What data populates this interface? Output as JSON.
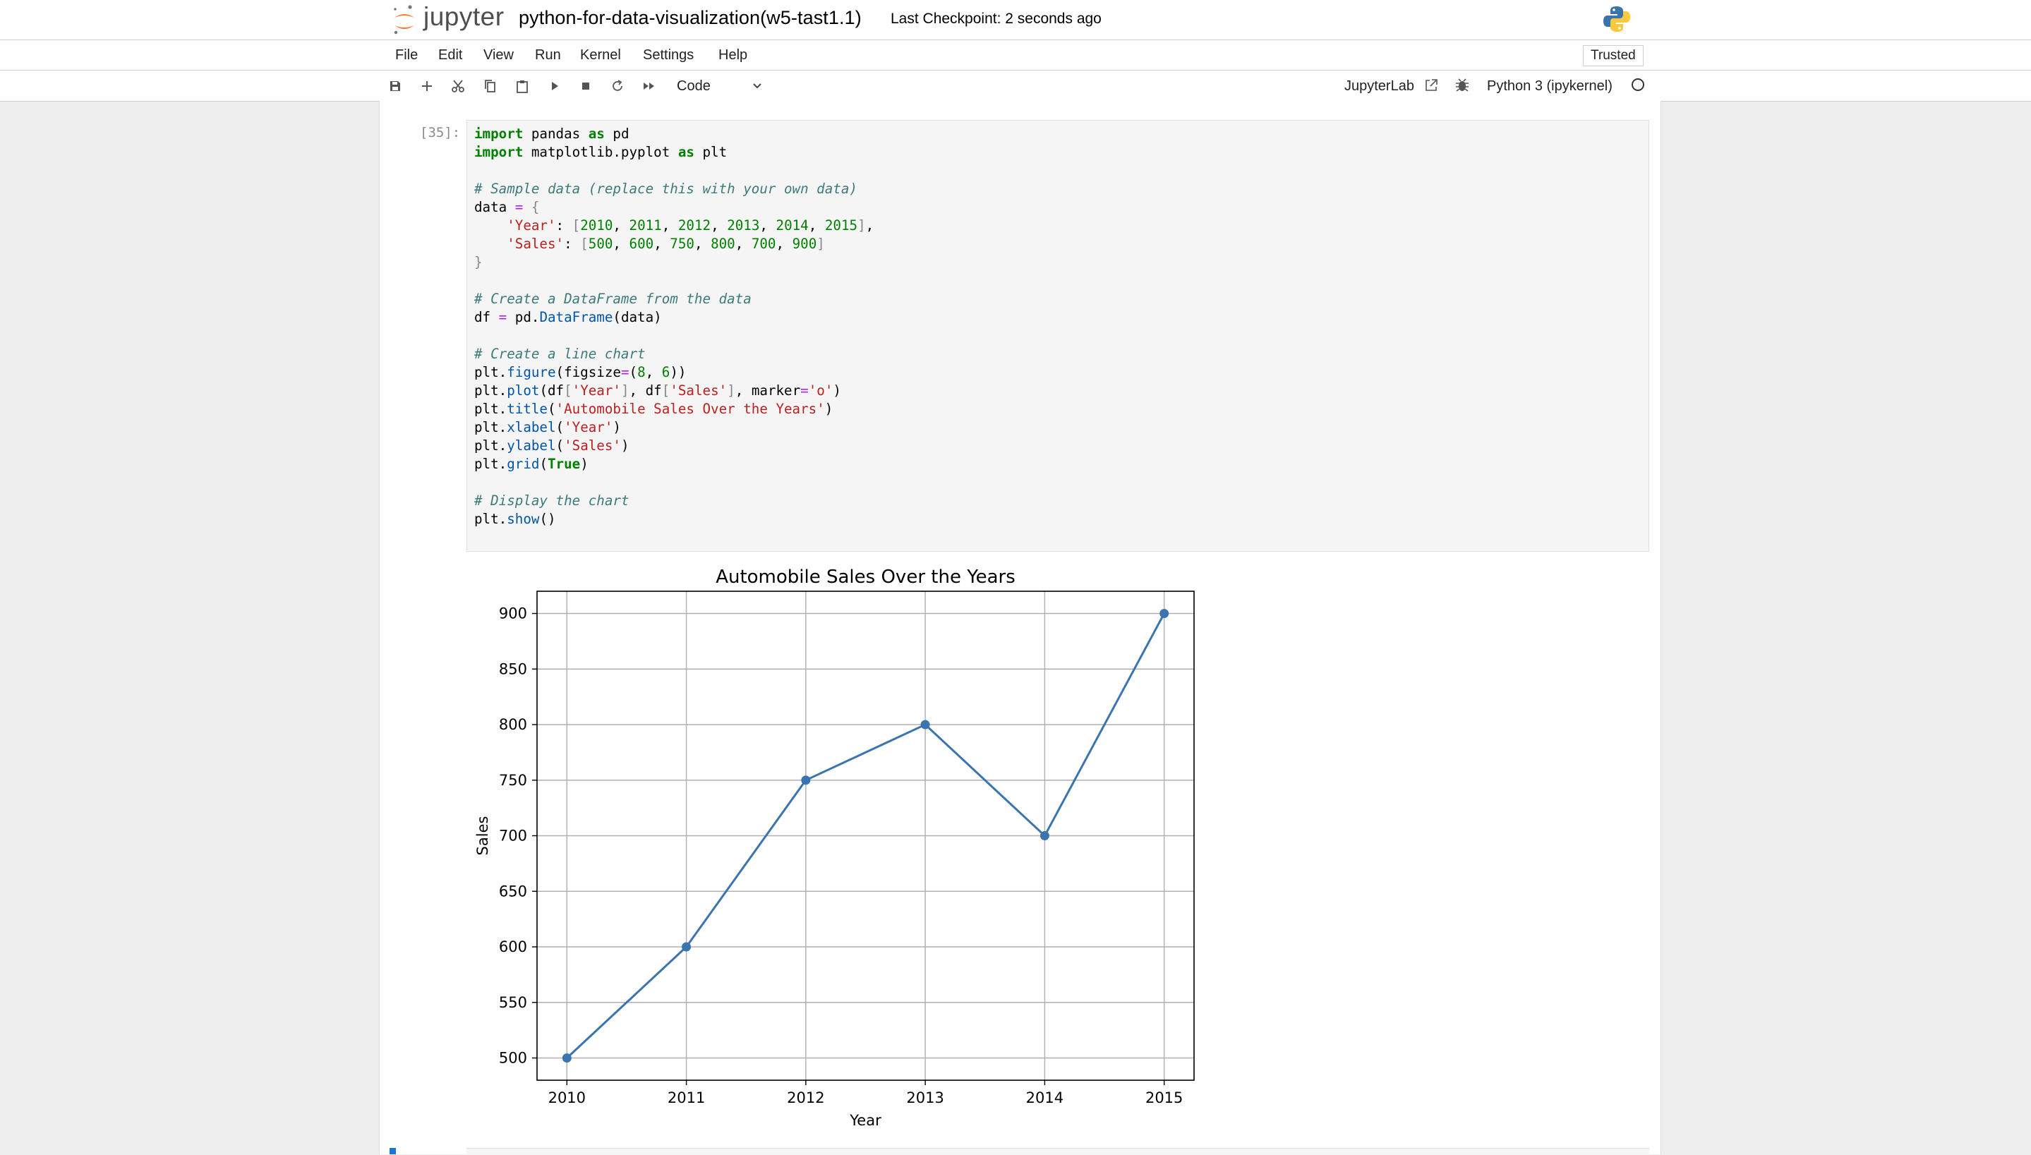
{
  "header": {
    "logo_text": "jupyter",
    "notebook_title": "python-for-data-visualization(w5-tast1.1)",
    "checkpoint": "Last Checkpoint: 2 seconds ago",
    "python_logo_icon": "python-logo-icon"
  },
  "menu": {
    "items": [
      "File",
      "Edit",
      "View",
      "Run",
      "Kernel",
      "Settings",
      "Help"
    ],
    "trusted": "Trusted"
  },
  "toolbar": {
    "icons": [
      "save-icon",
      "add-cell-icon",
      "cut-icon",
      "copy-icon",
      "paste-icon",
      "run-icon",
      "stop-icon",
      "restart-icon",
      "fast-forward-icon"
    ],
    "cell_type": "Code",
    "jupyterlab_link": "JupyterLab",
    "kernel_name": "Python 3 (ipykernel)"
  },
  "cell": {
    "prompt": "[35]:",
    "code_lines": [
      "import pandas as pd",
      "import matplotlib.pyplot as plt",
      "",
      "# Sample data (replace this with your own data)",
      "data = {",
      "    'Year': [2010, 2011, 2012, 2013, 2014, 2015],",
      "    'Sales': [500, 600, 750, 800, 700, 900]",
      "}",
      "",
      "# Create a DataFrame from the data",
      "df = pd.DataFrame(data)",
      "",
      "# Create a line chart",
      "plt.figure(figsize=(8, 6))",
      "plt.plot(df['Year'], df['Sales'], marker='o')",
      "plt.title('Automobile Sales Over the Years')",
      "plt.xlabel('Year')",
      "plt.ylabel('Sales')",
      "plt.grid(True)",
      "",
      "# Display the chart",
      "plt.show()"
    ]
  },
  "chart_data": {
    "type": "line",
    "title": "Automobile Sales Over the Years",
    "xlabel": "Year",
    "ylabel": "Sales",
    "x": [
      2010,
      2011,
      2012,
      2013,
      2014,
      2015
    ],
    "series": [
      {
        "values": [
          500,
          600,
          750,
          800,
          700,
          900
        ],
        "color": "#3b75af",
        "marker": "o"
      }
    ],
    "xticks": [
      2010,
      2011,
      2012,
      2013,
      2014,
      2015
    ],
    "yticks": [
      500,
      550,
      600,
      650,
      700,
      750,
      800,
      850,
      900
    ],
    "xlim": [
      2009.75,
      2015.25
    ],
    "ylim": [
      480,
      920
    ],
    "grid": true
  }
}
